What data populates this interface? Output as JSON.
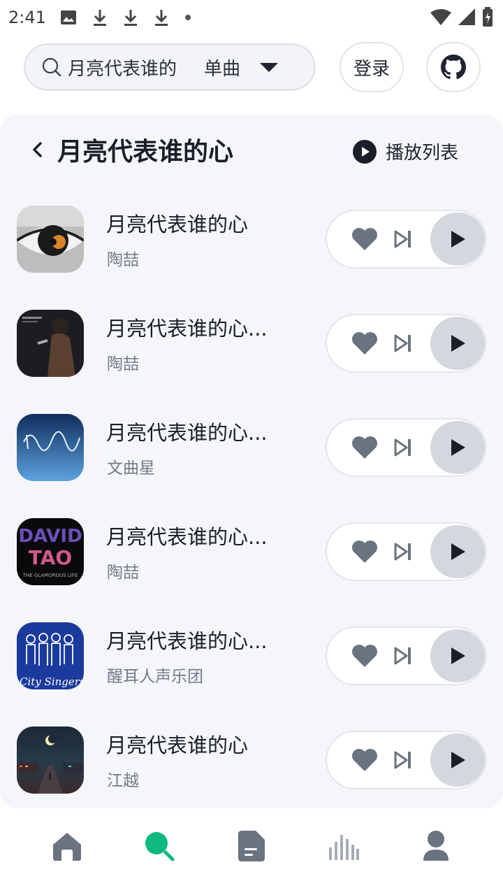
{
  "status_bar": {
    "time": "2:41"
  },
  "search": {
    "value": "月亮代表谁的",
    "type_label": "单曲"
  },
  "header": {
    "login_label": "登录"
  },
  "panel": {
    "title": "月亮代表谁的心",
    "playlist_label": "播放列表"
  },
  "songs": [
    {
      "title": "月亮代表谁的心",
      "artist": "陶喆",
      "cover": "eye-cover"
    },
    {
      "title": "月亮代表谁的心...",
      "artist": "陶喆",
      "cover": "singer-cover"
    },
    {
      "title": "月亮代表谁的心...",
      "artist": "文曲星",
      "cover": "blue-handwriting-cover"
    },
    {
      "title": "月亮代表谁的心...",
      "artist": "陶喆",
      "cover": "david-tao-cover",
      "cover_text": [
        "DAVID",
        "TAO",
        "THE GLAMOROUS LIFE"
      ]
    },
    {
      "title": "月亮代表谁的心...",
      "artist": "醒耳人声乐团",
      "cover": "city-singers-cover",
      "cover_text": [
        "City Singers"
      ]
    },
    {
      "title": "月亮代表谁的心",
      "artist": "江越",
      "cover": "night-street-cover"
    }
  ],
  "nav": [
    "home-icon",
    "search-icon",
    "document-icon",
    "chart-icon",
    "profile-icon"
  ],
  "colors": {
    "accent": "#10b981",
    "play_bg": "#d5d7de",
    "icon_gray": "#6b7280",
    "panel_bg": "#f5f6f9"
  }
}
